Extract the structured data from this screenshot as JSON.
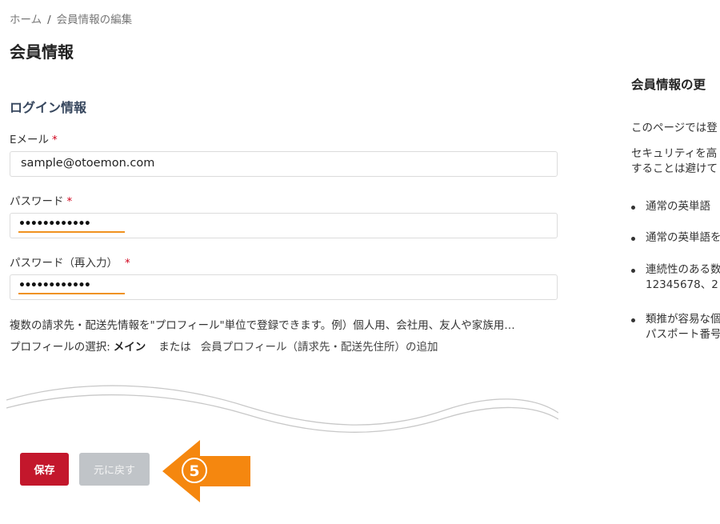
{
  "breadcrumb": {
    "home": "ホーム",
    "separator": "/",
    "current": "会員情報の編集"
  },
  "page_title": "会員情報",
  "login_section": {
    "title": "ログイン情報",
    "required_mark": "*",
    "email": {
      "label": "Eメール",
      "value": "sample@otoemon.com"
    },
    "password": {
      "label": "パスワード",
      "value": "••••••••••••"
    },
    "password_confirm": {
      "label": "パスワード（再入力）",
      "value": "••••••••••••"
    }
  },
  "profile": {
    "info_text": "複数の請求先・配送先情報を\"プロフィール\"単位で登録できます。例）個人用、会社用、友人や家族用…",
    "select_label": "プロフィールの選択:",
    "selected": "メイン",
    "or_text": "または",
    "add_link": "会員プロフィール（請求先・配送先住所）の追加"
  },
  "actions": {
    "save": "保存",
    "back": "元に戻す"
  },
  "annotation": {
    "step_number": "5",
    "color": "#f5870f"
  },
  "side_panel": {
    "title": "会員情報の更",
    "paragraph1": "このページでは登",
    "paragraph2_line1": "セキュリティを高",
    "paragraph2_line2": "することは避けて",
    "bullets": [
      [
        "通常の英単語"
      ],
      [
        "通常の英単語を"
      ],
      [
        "連続性のある数",
        "12345678、2"
      ],
      [
        "類推が容易な個",
        "パスポート番号"
      ]
    ]
  },
  "colors": {
    "primary_button": "#c3172c",
    "secondary_button": "#c0c4c8",
    "section_title": "#37475e",
    "required": "#d0021b",
    "input_highlight": "#f0921f"
  }
}
